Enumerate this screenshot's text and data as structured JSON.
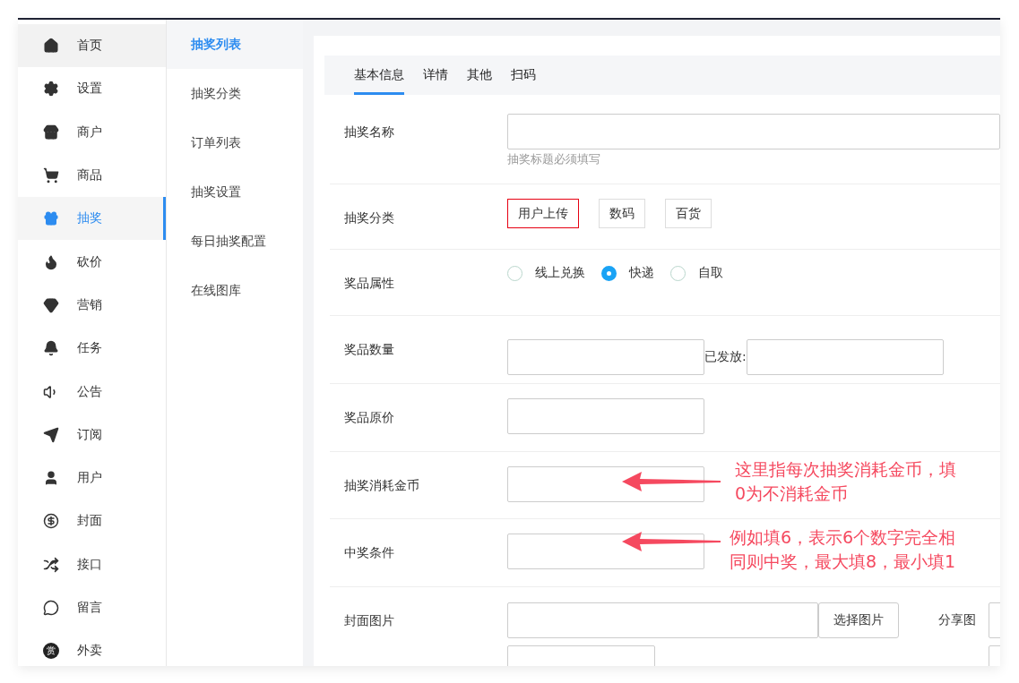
{
  "sidebar": {
    "items": [
      {
        "label": "首页",
        "selected": false,
        "hovered": true
      },
      {
        "label": "设置",
        "selected": false,
        "hovered": false
      },
      {
        "label": "商户",
        "selected": false,
        "hovered": false
      },
      {
        "label": "商品",
        "selected": false,
        "hovered": false
      },
      {
        "label": "抽奖",
        "selected": true,
        "hovered": false
      },
      {
        "label": "砍价",
        "selected": false,
        "hovered": false
      },
      {
        "label": "营销",
        "selected": false,
        "hovered": false
      },
      {
        "label": "任务",
        "selected": false,
        "hovered": false
      },
      {
        "label": "公告",
        "selected": false,
        "hovered": false
      },
      {
        "label": "订阅",
        "selected": false,
        "hovered": false
      },
      {
        "label": "用户",
        "selected": false,
        "hovered": false
      },
      {
        "label": "封面",
        "selected": false,
        "hovered": false
      },
      {
        "label": "接口",
        "selected": false,
        "hovered": false
      },
      {
        "label": "留言",
        "selected": false,
        "hovered": false
      },
      {
        "label": "外卖",
        "selected": false,
        "hovered": false,
        "badge": "赏"
      }
    ]
  },
  "submenu": {
    "items": [
      {
        "label": "抽奖列表",
        "selected": true
      },
      {
        "label": "抽奖分类",
        "selected": false
      },
      {
        "label": "订单列表",
        "selected": false
      },
      {
        "label": "抽奖设置",
        "selected": false
      },
      {
        "label": "每日抽奖配置",
        "selected": false
      },
      {
        "label": "在线图库",
        "selected": false
      }
    ]
  },
  "tabs": [
    {
      "label": "基本信息",
      "selected": true
    },
    {
      "label": "详情",
      "selected": false
    },
    {
      "label": "其他",
      "selected": false
    },
    {
      "label": "扫码",
      "selected": false
    }
  ],
  "form": {
    "rows": [
      {
        "kind": "text",
        "label": "抽奖名称",
        "hint": "抽奖标题必须填写"
      },
      {
        "kind": "tags",
        "label": "抽奖分类",
        "options": [
          {
            "label": "用户上传",
            "selected": true
          },
          {
            "label": "数码",
            "selected": false
          },
          {
            "label": "百货",
            "selected": false
          }
        ]
      },
      {
        "kind": "radio",
        "label": "奖品属性",
        "options": [
          {
            "label": "线上兑换",
            "selected": false
          },
          {
            "label": "快递",
            "selected": true
          },
          {
            "label": "自取",
            "selected": false
          }
        ]
      },
      {
        "kind": "pair",
        "label": "奖品数量",
        "second_label": "已发放:"
      },
      {
        "kind": "single",
        "label": "奖品原价"
      },
      {
        "kind": "single",
        "label": "抽奖消耗金币",
        "note": "这里指每次抽奖消耗金币，填0为不消耗金币"
      },
      {
        "kind": "single",
        "label": "中奖条件",
        "note": "例如填6，表示6个数字完全相同则中奖，最大填8，最小填1"
      },
      {
        "kind": "image",
        "label": "封面图片",
        "button": "选择图片",
        "second_label": "分享图"
      }
    ]
  }
}
